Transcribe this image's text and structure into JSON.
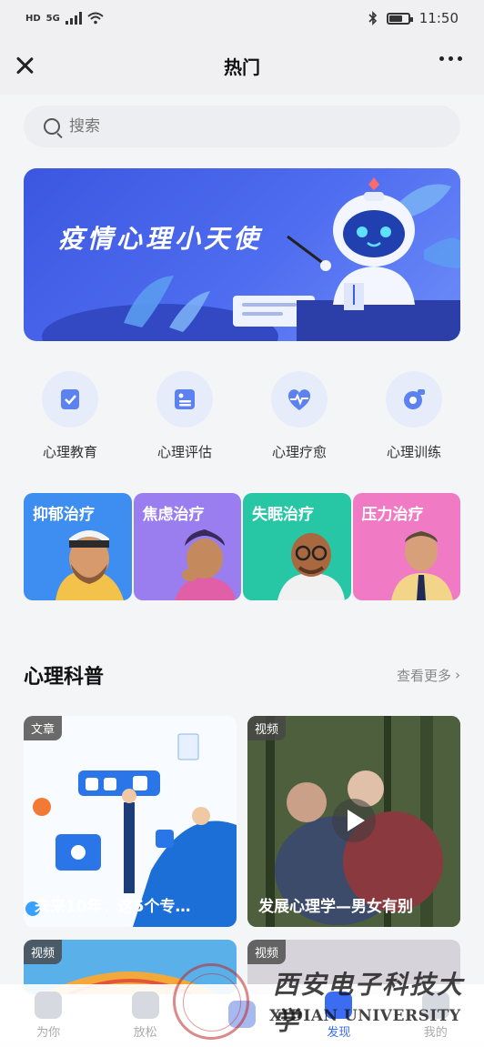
{
  "status_bar": {
    "left_badges": "HD",
    "network": "5G",
    "time": "11:50"
  },
  "nav": {
    "title": "热门"
  },
  "search": {
    "placeholder": "搜索"
  },
  "banner": {
    "title": "疫情心理小天使"
  },
  "quick_links": [
    {
      "label": "心理教育",
      "icon": "book-check-icon"
    },
    {
      "label": "心理评估",
      "icon": "clipboard-icon"
    },
    {
      "label": "心理疗愈",
      "icon": "heartbeat-icon"
    },
    {
      "label": "心理训练",
      "icon": "training-icon"
    }
  ],
  "therapy_cards": [
    {
      "label": "抑郁治疗",
      "color": "#3e8df0"
    },
    {
      "label": "焦虑治疗",
      "color": "#9a7ef0"
    },
    {
      "label": "失眠治疗",
      "color": "#27c7a6"
    },
    {
      "label": "压力治疗",
      "color": "#f07ac4"
    }
  ],
  "section": {
    "title": "心理科普",
    "more": "查看更多"
  },
  "articles": [
    {
      "tag": "文章",
      "caption": "未来10年，这5个专…"
    },
    {
      "tag": "视频",
      "caption": "发展心理学—男女有别"
    },
    {
      "tag": "视频",
      "caption": ""
    },
    {
      "tag": "视频",
      "caption": ""
    }
  ],
  "tabbar": [
    {
      "label": "为你",
      "icon": "heart-icon",
      "active": false
    },
    {
      "label": "放松",
      "icon": "play-icon",
      "active": false
    },
    {
      "label": "",
      "icon": "center-icon",
      "active": false
    },
    {
      "label": "发现",
      "icon": "discover-icon",
      "active": true
    },
    {
      "label": "我的",
      "icon": "profile-icon",
      "active": false
    }
  ],
  "watermark": {
    "chinese": "西安电子科技大学",
    "english": "XIDIAN UNIVERSITY"
  }
}
